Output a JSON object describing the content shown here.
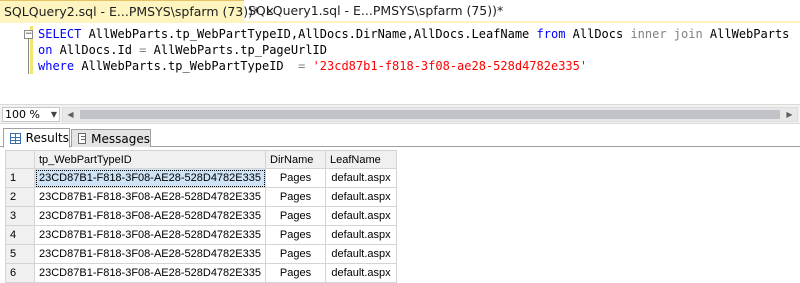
{
  "tabs": [
    {
      "title": "SQLQuery2.sql - E...PMSYS\\spfarm (73))*",
      "active": true
    },
    {
      "title": "SQLQuery1.sql - E...PMSYS\\spfarm (75))*",
      "active": false
    }
  ],
  "editor": {
    "lines": [
      {
        "keyword": "SELECT",
        "body": " AllWebParts.tp_WebPartTypeID,AllDocs.DirName,AllDocs.LeafName ",
        "kw2": "from",
        "body2": " AllDocs ",
        "gray": "inner join",
        "body3": " AllWebParts"
      },
      {
        "keyword": "on",
        "body": " AllDocs.Id ",
        "gray": "=",
        "body2": " AllWebParts.tp_PageUrlID"
      },
      {
        "keyword": "where",
        "body": " AllWebParts.tp_WebPartTypeID  ",
        "gray": "=",
        "space": " ",
        "string": "'23cd87b1-f818-3f08-ae28-528d4782e335'"
      }
    ]
  },
  "zoom": {
    "value": "100 %"
  },
  "result_tabs": {
    "results": "Results",
    "messages": "Messages"
  },
  "grid": {
    "columns": [
      "tp_WebPartTypeID",
      "DirName",
      "LeafName"
    ],
    "rows": [
      [
        "1",
        "23CD87B1-F818-3F08-AE28-528D4782E335",
        "Pages",
        "default.aspx"
      ],
      [
        "2",
        "23CD87B1-F818-3F08-AE28-528D4782E335",
        "Pages",
        "default.aspx"
      ],
      [
        "3",
        "23CD87B1-F818-3F08-AE28-528D4782E335",
        "Pages",
        "default.aspx"
      ],
      [
        "4",
        "23CD87B1-F818-3F08-AE28-528D4782E335",
        "Pages",
        "default.aspx"
      ],
      [
        "5",
        "23CD87B1-F818-3F08-AE28-528D4782E335",
        "Pages",
        "default.aspx"
      ],
      [
        "6",
        "23CD87B1-F818-3F08-AE28-528D4782E335",
        "Pages",
        "default.aspx"
      ]
    ]
  },
  "colors": {
    "active_tab": "#fdf4bf",
    "keyword": "#0000ff",
    "operator": "#808080",
    "string": "#ff0000",
    "selected_cell": "#cfe3f7"
  }
}
